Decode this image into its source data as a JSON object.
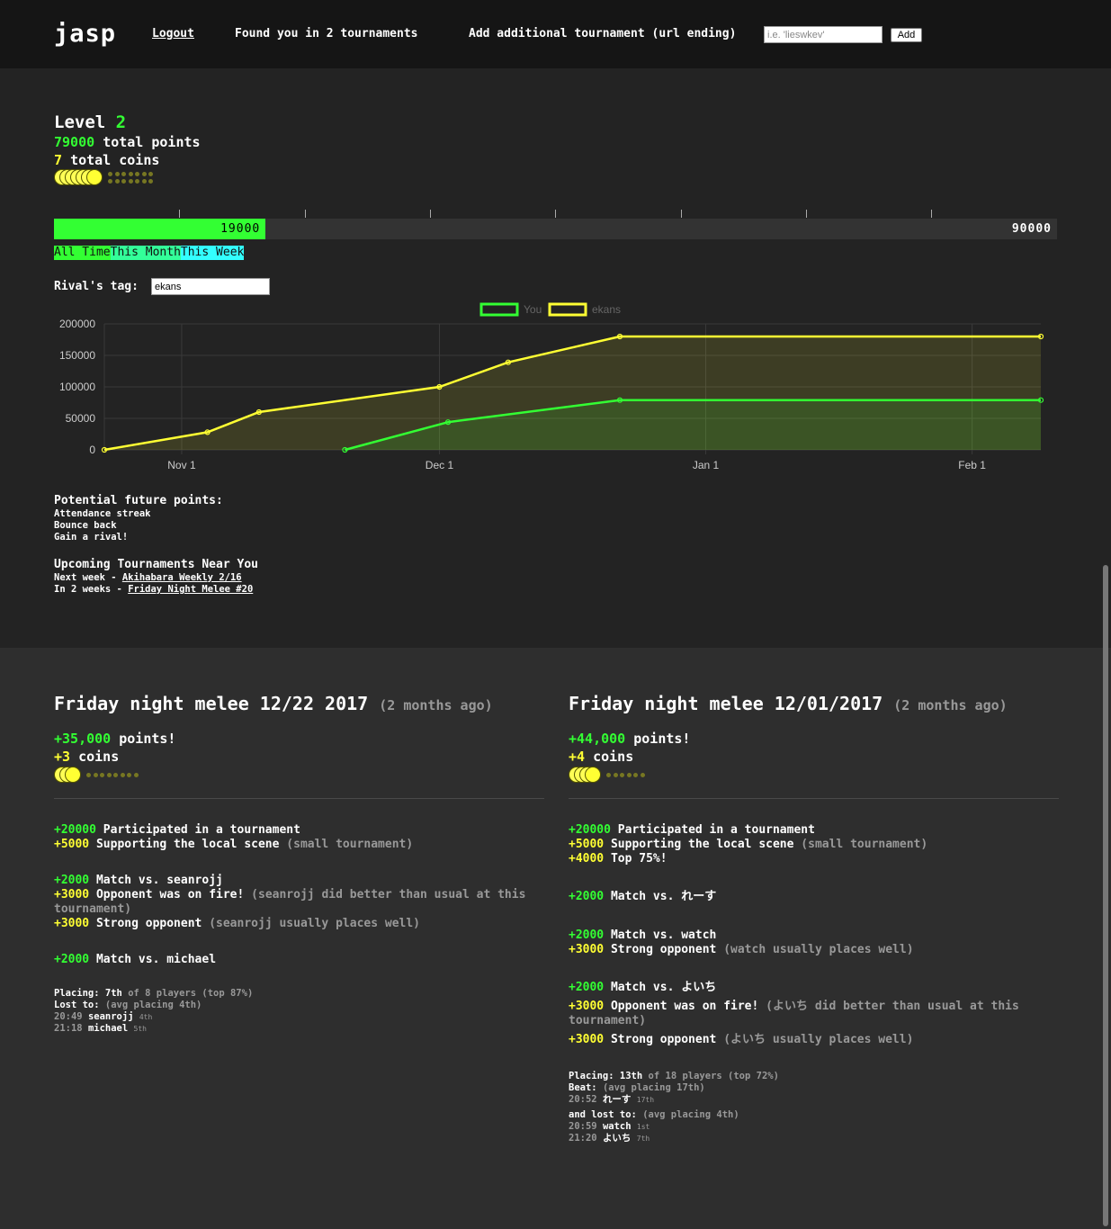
{
  "header": {
    "logo": "jasp",
    "logout": "Logout",
    "found": "Found you in 2 tournaments",
    "add_label": "Add additional tournament (url ending)",
    "add_placeholder": "i.e. 'lieswkev'",
    "add_button": "Add"
  },
  "stats": {
    "level_label": "Level",
    "level": "2",
    "total_points": "79000",
    "total_points_label": "total points",
    "total_coins": "7",
    "total_coins_label": "total coins",
    "coins_filled": 7,
    "coins_empty": 14
  },
  "progress": {
    "current": "19000",
    "max": "90000",
    "fraction": 0.211
  },
  "filters": [
    "All Time",
    "This Month",
    "This Week"
  ],
  "rival": {
    "label": "Rival's tag:",
    "value": "ekans"
  },
  "colors": {
    "you": "#33ff33",
    "rival": "#ffff33",
    "grid": "#3a3a3a"
  },
  "chart_data": {
    "type": "area",
    "legend_position": "top-center",
    "grid": true,
    "x_ticks": [
      "Nov 1",
      "Dec 1",
      "Jan 1",
      "Feb 1"
    ],
    "x_range": [
      "2017-10-23",
      "2018-02-09"
    ],
    "ylim": [
      0,
      200000
    ],
    "y_ticks": [
      0,
      50000,
      100000,
      150000,
      200000
    ],
    "series": [
      {
        "name": "You",
        "points": [
          {
            "x": "2017-11-20",
            "y": 0
          },
          {
            "x": "2017-12-02",
            "y": 44000
          },
          {
            "x": "2017-12-22",
            "y": 79000
          },
          {
            "x": "2018-02-09",
            "y": 79000
          }
        ]
      },
      {
        "name": "ekans",
        "points": [
          {
            "x": "2017-10-23",
            "y": 0
          },
          {
            "x": "2017-11-04",
            "y": 28000
          },
          {
            "x": "2017-11-10",
            "y": 60000
          },
          {
            "x": "2017-12-01",
            "y": 100000
          },
          {
            "x": "2017-12-09",
            "y": 139000
          },
          {
            "x": "2017-12-22",
            "y": 180000
          },
          {
            "x": "2018-02-09",
            "y": 180000
          }
        ]
      }
    ]
  },
  "future": {
    "title": "Potential future points:",
    "items": [
      "Attendance streak",
      "Bounce back",
      "Gain a rival!"
    ]
  },
  "upcoming": {
    "title": "Upcoming Tournaments Near You",
    "items": [
      {
        "when": "Next week - ",
        "name": "Akihabara Weekly 2/16"
      },
      {
        "when": "In 2 weeks - ",
        "name": "Friday Night Melee #20"
      }
    ]
  },
  "cards": [
    {
      "title": "Friday night melee 12/22 2017",
      "ago": "(2 months ago)",
      "points": "+35,000",
      "points_label": "points!",
      "coins": "+3",
      "coins_label": "coins",
      "coins_filled": 3,
      "coins_empty": 8,
      "lines": [
        {
          "pts": "+20000",
          "text": "Participated in a tournament",
          "note": "",
          "y": 195,
          "color": "green"
        },
        {
          "pts": "+5000",
          "text": "Supporting the local scene",
          "note": "(small tournament)",
          "y": 211,
          "color": "yellow"
        },
        {
          "pts": "+2000",
          "text": "Match vs. seanrojj",
          "note": "",
          "y": 251,
          "color": "green"
        },
        {
          "pts": "+3000",
          "text": "Opponent was on fire!",
          "note": "(seanrojj did better than usual at this tournament)",
          "y": 267,
          "color": "yellow",
          "wrap": true
        },
        {
          "pts": "+3000",
          "text": "Strong opponent",
          "note": "(seanrojj usually places well)",
          "y": 299,
          "color": "yellow"
        },
        {
          "pts": "+2000",
          "text": "Match vs. michael",
          "note": "",
          "y": 339,
          "color": "green"
        }
      ],
      "placing": {
        "label": "Placing:",
        "value": "7th",
        "rest": "of 8 players (top 87%)",
        "y": 378
      },
      "sections": [
        {
          "label": "Lost to:",
          "note": "(avg placing 4th)",
          "y": 391,
          "rows": [
            {
              "time": "20:49",
              "name": "seanrojj",
              "place": "4th"
            },
            {
              "time": "21:18",
              "name": "michael",
              "place": "5th"
            }
          ]
        }
      ]
    },
    {
      "title": "Friday night melee 12/01/2017",
      "ago": "(2 months ago)",
      "points": "+44,000",
      "points_label": "points!",
      "coins": "+4",
      "coins_label": "coins",
      "coins_filled": 4,
      "coins_empty": 6,
      "lines": [
        {
          "pts": "+20000",
          "text": "Participated in a tournament",
          "note": "",
          "y": 195,
          "color": "green"
        },
        {
          "pts": "+5000",
          "text": "Supporting the local scene",
          "note": "(small tournament)",
          "y": 211,
          "color": "yellow"
        },
        {
          "pts": "+4000",
          "text": "Top 75%!",
          "note": "",
          "y": 227,
          "color": "yellow"
        },
        {
          "pts": "+2000",
          "text": "Match vs. れーす",
          "note": "",
          "y": 269,
          "color": "green"
        },
        {
          "pts": "+2000",
          "text": "Match vs. watch",
          "note": "",
          "y": 312,
          "color": "green"
        },
        {
          "pts": "+3000",
          "text": "Strong opponent",
          "note": "(watch usually places well)",
          "y": 328,
          "color": "yellow"
        },
        {
          "pts": "+2000",
          "text": "Match vs. よいち",
          "note": "",
          "y": 370,
          "color": "green"
        },
        {
          "pts": "+3000",
          "text": "Opponent was on fire!",
          "note": "(よいち did better than usual at this tournament)",
          "y": 391,
          "color": "yellow",
          "wrap": true
        },
        {
          "pts": "+3000",
          "text": "Strong opponent",
          "note": "(よいち usually places well)",
          "y": 428,
          "color": "yellow"
        }
      ],
      "placing": {
        "label": "Placing:",
        "value": "13th",
        "rest": "of 18 players (top 72%)",
        "y": 470
      },
      "sections": [
        {
          "label": "Beat:",
          "note": "(avg placing 17th)",
          "y": 483,
          "rows": [
            {
              "time": "20:52",
              "name": "れーす",
              "place": "17th"
            }
          ]
        },
        {
          "label": "and lost to:",
          "note": "(avg placing 4th)",
          "y": 513,
          "rows": [
            {
              "time": "20:59",
              "name": "watch",
              "place": "1st"
            },
            {
              "time": "21:20",
              "name": "よいち",
              "place": "7th"
            }
          ]
        }
      ]
    }
  ]
}
